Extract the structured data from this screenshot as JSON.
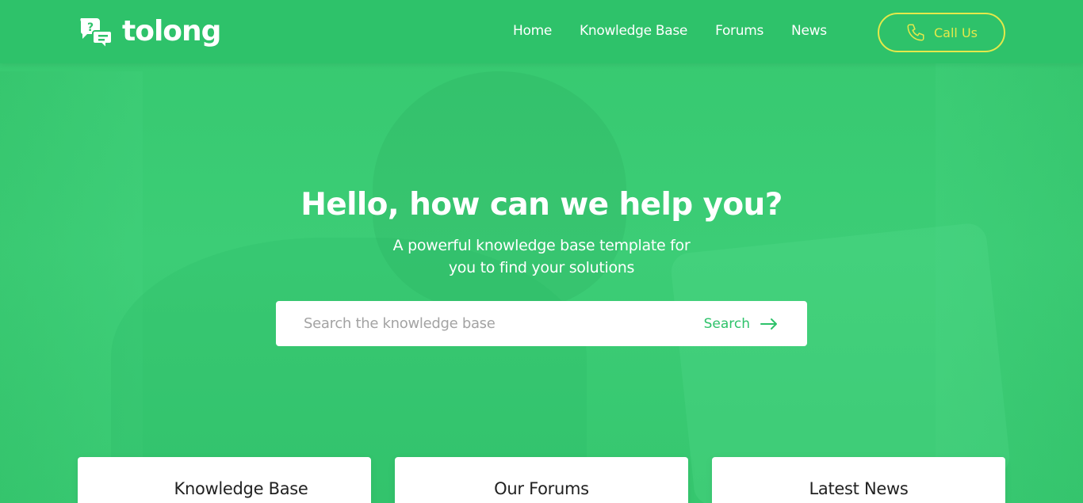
{
  "brand": {
    "name": "tolong",
    "primary": "#2ec26a",
    "accent": "#e4e94a",
    "icon": "chat-question-icon"
  },
  "nav": {
    "items": [
      {
        "label": "Home"
      },
      {
        "label": "Knowledge Base"
      },
      {
        "label": "Forums"
      },
      {
        "label": "News"
      }
    ]
  },
  "call": {
    "label": "Call Us",
    "icon": "phone-icon"
  },
  "hero": {
    "title": "Hello, how can we help you?",
    "subtitle_line1": "A powerful knowledge base template for",
    "subtitle_line2": "you to find your solutions"
  },
  "search": {
    "placeholder": "Search the knowledge base",
    "value": "",
    "button_label": "Search",
    "button_icon": "arrow-right-icon"
  },
  "cards": [
    {
      "title": "Knowledge Base"
    },
    {
      "title": "Our Forums"
    },
    {
      "title": "Latest News"
    }
  ]
}
